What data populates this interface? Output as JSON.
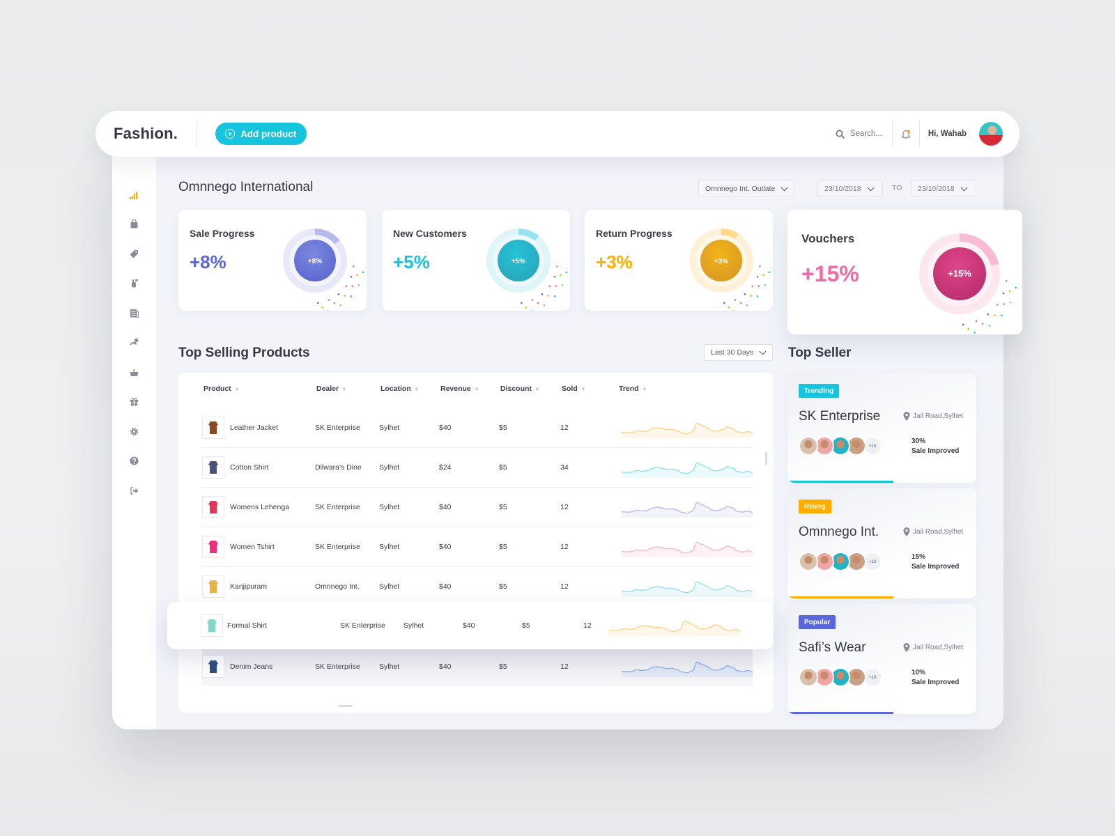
{
  "app": {
    "brand": "Fashion.",
    "add_product_label": "Add product"
  },
  "topbar": {
    "search_placeholder": "Search...",
    "greeting": "Hi, Wahab",
    "notification_dot_color": "#ff9f1c"
  },
  "sidebar": {
    "items": [
      {
        "icon": "analytics-icon",
        "active": true
      },
      {
        "icon": "bag-icon"
      },
      {
        "icon": "tag-icon"
      },
      {
        "icon": "hand-pointer-icon"
      },
      {
        "icon": "newspaper-icon"
      },
      {
        "icon": "hand-coins-icon"
      },
      {
        "icon": "basket-icon"
      },
      {
        "icon": "gift-icon"
      },
      {
        "icon": "gear-icon"
      },
      {
        "icon": "help-icon"
      },
      {
        "icon": "logout-icon"
      }
    ]
  },
  "header": {
    "title": "Omnnego International",
    "outlet_select": "Omnnego Int. Outlate",
    "date_from": "23/10/2018",
    "to_label": "TO",
    "date_to": "23/10/2018"
  },
  "stats": [
    {
      "label": "Sale Progress",
      "value": "+8%",
      "ring_label": "+8%",
      "fraction": 0.08,
      "color": "#5a67d8",
      "inner": [
        "#7c89e0",
        "#5b67cf"
      ],
      "track": "#e7e9f8"
    },
    {
      "label": "New Customers",
      "value": "+5%",
      "ring_label": "+5%",
      "fraction": 0.05,
      "color": "#16c4dd",
      "inner": [
        "#23c2d8",
        "#2aa7b9"
      ],
      "track": "#def5fa"
    },
    {
      "label": "Return Progress",
      "value": "+3%",
      "ring_label": "+3%",
      "fraction": 0.03,
      "color": "#ffae00",
      "inner": [
        "#f4b21b",
        "#d89a22"
      ],
      "track": "#fff1d8"
    },
    {
      "label": "Vouchers",
      "value": "+15%",
      "ring_label": "+15%",
      "fraction": 0.15,
      "color": "#f06aa3",
      "inner": [
        "#e0468b",
        "#b82f6c"
      ],
      "track": "#fde7ef"
    }
  ],
  "top_selling": {
    "title": "Top Selling Products",
    "range_select": "Last 30 Days",
    "columns": [
      "Product",
      "Dealer",
      "Location",
      "Revenue",
      "Discount",
      "Sold",
      "Trend"
    ],
    "rows": [
      {
        "product": "Leather Jacket",
        "dealer": "SK Enterprise",
        "location": "Sylhet",
        "revenue": "$40",
        "discount": "$5",
        "sold": "12",
        "trend_color": "#ffd48a",
        "thumb_color": "#8a4a22"
      },
      {
        "product": "Cotton Shirt",
        "dealer": "Dilwara's Dine",
        "location": "Sylhet",
        "revenue": "$24",
        "discount": "$5",
        "sold": "34",
        "trend_color": "#8fe3f0",
        "thumb_color": "#4a5275"
      },
      {
        "product": "Womens Lehenga",
        "dealer": "SK Enterprise",
        "location": "Sylhet",
        "revenue": "$40",
        "discount": "$5",
        "sold": "12",
        "trend_color": "#b9bdea",
        "thumb_color": "#e0365c"
      },
      {
        "product": "Women Tshirt",
        "dealer": "SK Enterprise",
        "location": "Sylhet",
        "revenue": "$40",
        "discount": "$5",
        "sold": "12",
        "trend_color": "#f7b9c8",
        "thumb_color": "#ec2f7f"
      },
      {
        "product": "Kanjipuram",
        "dealer": "Omnnego Int.",
        "location": "Sylhet",
        "revenue": "$40",
        "discount": "$5",
        "sold": "12",
        "trend_color": "#9fe0ee",
        "thumb_color": "#e7b34a"
      },
      {
        "product": "Formal  Shirt",
        "dealer": "SK Enterprise",
        "location": "Sylhet",
        "revenue": "$40",
        "discount": "$5",
        "sold": "12",
        "trend_color": "#ffd48a",
        "thumb_color": "#7fd9c6"
      },
      {
        "product": "Denim Jeans",
        "dealer": "SK Enterprise",
        "location": "Sylhet",
        "revenue": "$40",
        "discount": "$5",
        "sold": "12",
        "trend_color": "#8fb7ea",
        "thumb_color": "#2f4d82"
      }
    ],
    "trend_series": [
      0.25,
      0.22,
      0.24,
      0.35,
      0.3,
      0.33,
      0.48,
      0.55,
      0.5,
      0.42,
      0.44,
      0.36,
      0.2,
      0.15,
      0.28,
      0.85,
      0.7,
      0.55,
      0.35,
      0.32,
      0.42,
      0.6,
      0.5,
      0.28,
      0.22,
      0.3,
      0.2
    ]
  },
  "top_seller": {
    "title": "Top Seller",
    "sellers": [
      {
        "badge": "Trending",
        "badge_color": "#16c4dd",
        "name": "SK Enterprise",
        "location": "Jail Road,Sylhet",
        "more": "+10",
        "percent": "30%",
        "caption": "Sale Improved",
        "progress": 0.56
      },
      {
        "badge": "Rising",
        "badge_color": "#ffae00",
        "name": "Omnnego Int.",
        "location": "Jail Road,Sylhet",
        "more": "+10",
        "percent": "15%",
        "caption": "Sale Improved",
        "progress": 0.56
      },
      {
        "badge": "Popular",
        "badge_color": "#5a67d8",
        "name": "Safi’s Wear",
        "location": "Jail Road,Sylhet",
        "more": "+10",
        "percent": "10%",
        "caption": "Sale Improved",
        "progress": 0.56
      }
    ]
  }
}
